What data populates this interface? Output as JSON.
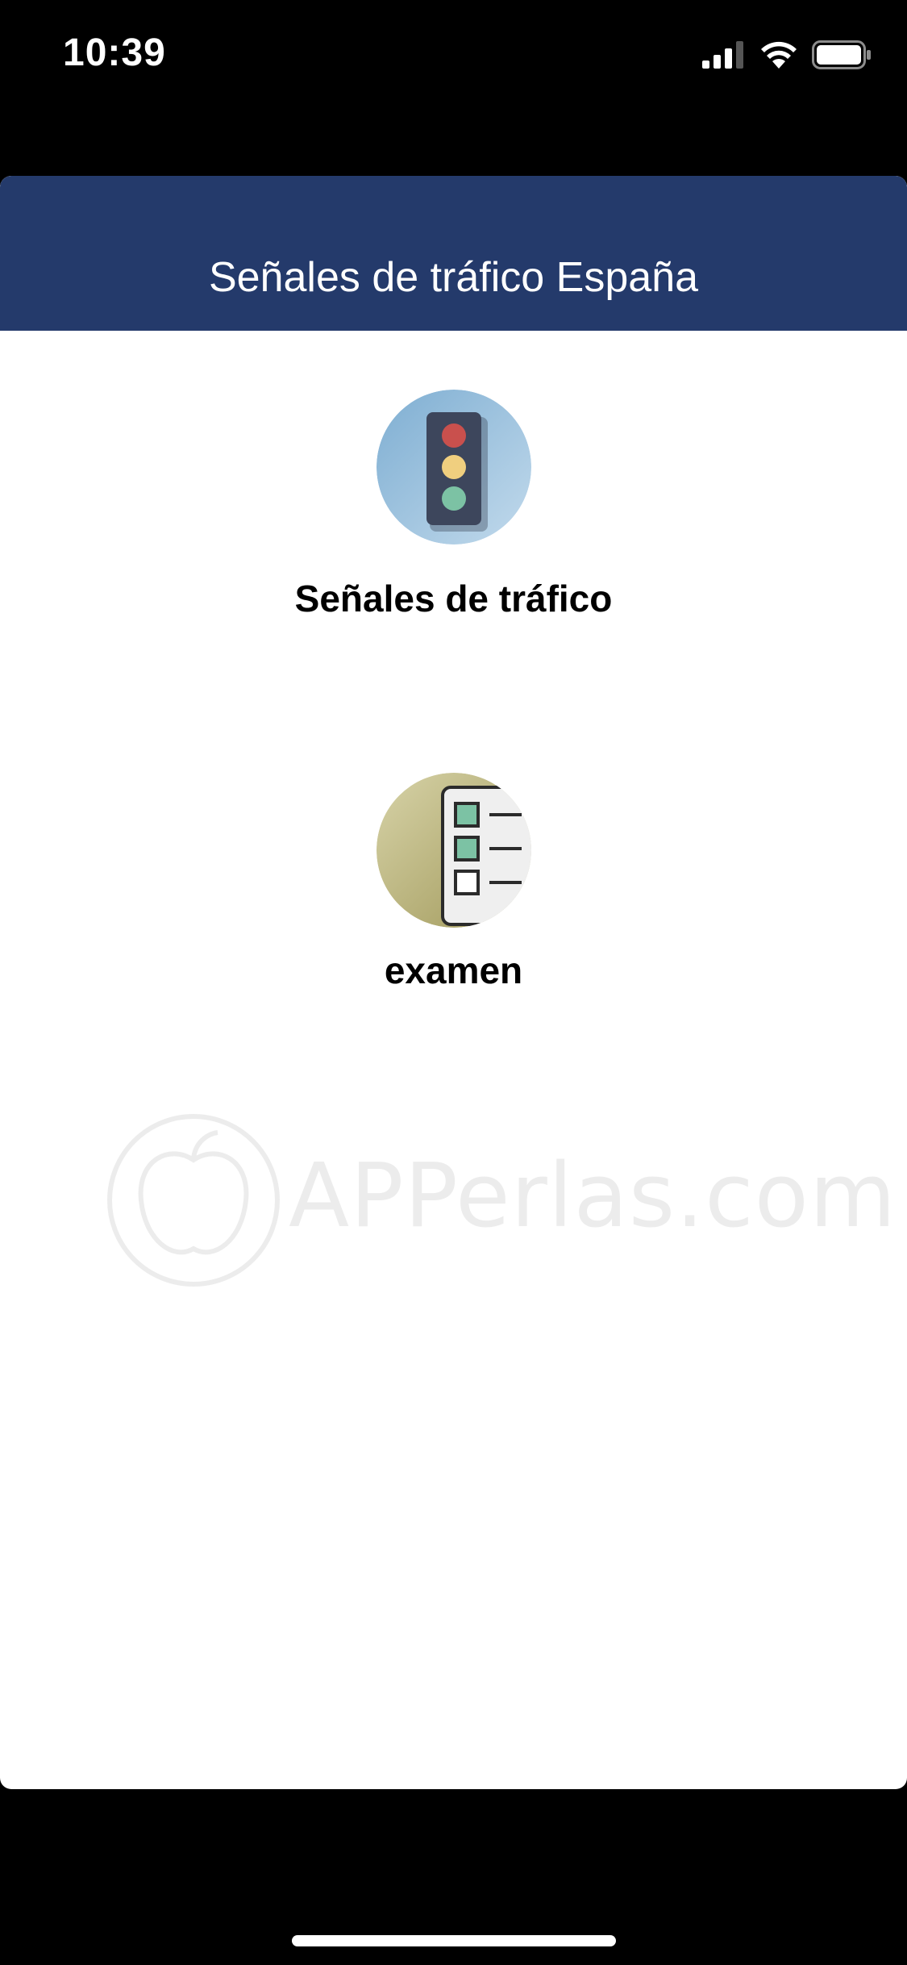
{
  "status_bar": {
    "time": "10:39",
    "icons": [
      "cellular-signal-icon",
      "wifi-icon",
      "battery-icon"
    ]
  },
  "nav": {
    "title": "Señales de tráfico España"
  },
  "menu": [
    {
      "label": "Señales de tráfico",
      "icon": "traffic-light-icon"
    },
    {
      "label": "examen",
      "icon": "checklist-icon"
    }
  ],
  "watermark": {
    "text": "APPerlas.com"
  },
  "colors": {
    "nav_background": "#243a6b",
    "page_background": "#ffffff",
    "system_background": "#000000"
  }
}
